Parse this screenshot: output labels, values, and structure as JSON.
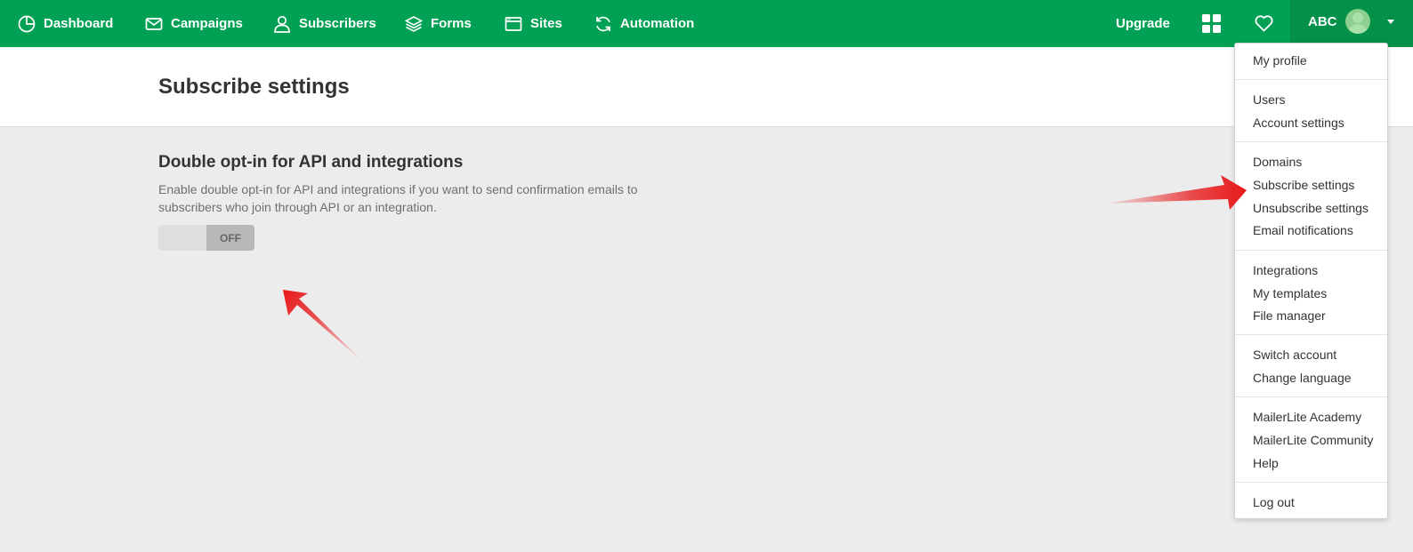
{
  "nav": {
    "items": [
      {
        "label": "Dashboard",
        "icon": "dashboard-icon"
      },
      {
        "label": "Campaigns",
        "icon": "envelope-icon"
      },
      {
        "label": "Subscribers",
        "icon": "user-icon"
      },
      {
        "label": "Forms",
        "icon": "layers-icon"
      },
      {
        "label": "Sites",
        "icon": "browser-window-icon"
      },
      {
        "label": "Automation",
        "icon": "refresh-icon"
      }
    ],
    "upgrade": "Upgrade",
    "account": "ABC"
  },
  "page": {
    "title": "Subscribe settings"
  },
  "section": {
    "title": "Double opt-in for API and integrations",
    "description": "Enable double opt-in for API and integrations if you want to send confirmation emails to subscribers who join through API or an integration.",
    "toggle_label": "OFF"
  },
  "menu": {
    "items": [
      "My profile",
      "Users",
      "Account settings",
      "Domains",
      "Subscribe settings",
      "Unsubscribe settings",
      "Email notifications",
      "Integrations",
      "My templates",
      "File manager",
      "Switch account",
      "Change language",
      "MailerLite Academy",
      "MailerLite Community",
      "Help",
      "Log out"
    ]
  },
  "colors": {
    "brand_green": "#00a154",
    "annotation_red": "#e8191a"
  }
}
